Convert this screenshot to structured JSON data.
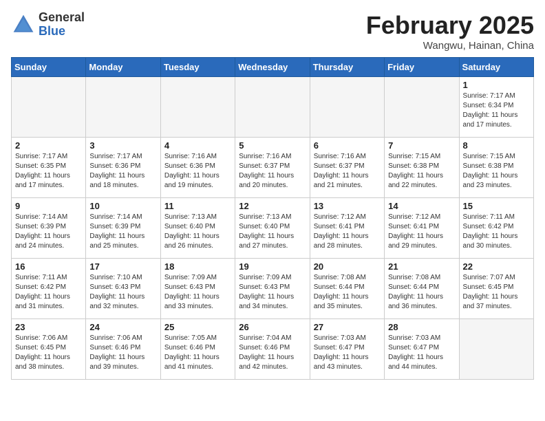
{
  "header": {
    "logo": {
      "line1": "General",
      "line2": "Blue"
    },
    "title": "February 2025",
    "location": "Wangwu, Hainan, China"
  },
  "weekdays": [
    "Sunday",
    "Monday",
    "Tuesday",
    "Wednesday",
    "Thursday",
    "Friday",
    "Saturday"
  ],
  "weeks": [
    [
      {
        "day": null
      },
      {
        "day": null
      },
      {
        "day": null
      },
      {
        "day": null
      },
      {
        "day": null
      },
      {
        "day": null
      },
      {
        "day": 1,
        "sunrise": "7:17 AM",
        "sunset": "6:34 PM",
        "daylight": "11 hours and 17 minutes."
      }
    ],
    [
      {
        "day": 2,
        "sunrise": "7:17 AM",
        "sunset": "6:35 PM",
        "daylight": "11 hours and 17 minutes."
      },
      {
        "day": 3,
        "sunrise": "7:17 AM",
        "sunset": "6:36 PM",
        "daylight": "11 hours and 18 minutes."
      },
      {
        "day": 4,
        "sunrise": "7:16 AM",
        "sunset": "6:36 PM",
        "daylight": "11 hours and 19 minutes."
      },
      {
        "day": 5,
        "sunrise": "7:16 AM",
        "sunset": "6:37 PM",
        "daylight": "11 hours and 20 minutes."
      },
      {
        "day": 6,
        "sunrise": "7:16 AM",
        "sunset": "6:37 PM",
        "daylight": "11 hours and 21 minutes."
      },
      {
        "day": 7,
        "sunrise": "7:15 AM",
        "sunset": "6:38 PM",
        "daylight": "11 hours and 22 minutes."
      },
      {
        "day": 8,
        "sunrise": "7:15 AM",
        "sunset": "6:38 PM",
        "daylight": "11 hours and 23 minutes."
      }
    ],
    [
      {
        "day": 9,
        "sunrise": "7:14 AM",
        "sunset": "6:39 PM",
        "daylight": "11 hours and 24 minutes."
      },
      {
        "day": 10,
        "sunrise": "7:14 AM",
        "sunset": "6:39 PM",
        "daylight": "11 hours and 25 minutes."
      },
      {
        "day": 11,
        "sunrise": "7:13 AM",
        "sunset": "6:40 PM",
        "daylight": "11 hours and 26 minutes."
      },
      {
        "day": 12,
        "sunrise": "7:13 AM",
        "sunset": "6:40 PM",
        "daylight": "11 hours and 27 minutes."
      },
      {
        "day": 13,
        "sunrise": "7:12 AM",
        "sunset": "6:41 PM",
        "daylight": "11 hours and 28 minutes."
      },
      {
        "day": 14,
        "sunrise": "7:12 AM",
        "sunset": "6:41 PM",
        "daylight": "11 hours and 29 minutes."
      },
      {
        "day": 15,
        "sunrise": "7:11 AM",
        "sunset": "6:42 PM",
        "daylight": "11 hours and 30 minutes."
      }
    ],
    [
      {
        "day": 16,
        "sunrise": "7:11 AM",
        "sunset": "6:42 PM",
        "daylight": "11 hours and 31 minutes."
      },
      {
        "day": 17,
        "sunrise": "7:10 AM",
        "sunset": "6:43 PM",
        "daylight": "11 hours and 32 minutes."
      },
      {
        "day": 18,
        "sunrise": "7:09 AM",
        "sunset": "6:43 PM",
        "daylight": "11 hours and 33 minutes."
      },
      {
        "day": 19,
        "sunrise": "7:09 AM",
        "sunset": "6:43 PM",
        "daylight": "11 hours and 34 minutes."
      },
      {
        "day": 20,
        "sunrise": "7:08 AM",
        "sunset": "6:44 PM",
        "daylight": "11 hours and 35 minutes."
      },
      {
        "day": 21,
        "sunrise": "7:08 AM",
        "sunset": "6:44 PM",
        "daylight": "11 hours and 36 minutes."
      },
      {
        "day": 22,
        "sunrise": "7:07 AM",
        "sunset": "6:45 PM",
        "daylight": "11 hours and 37 minutes."
      }
    ],
    [
      {
        "day": 23,
        "sunrise": "7:06 AM",
        "sunset": "6:45 PM",
        "daylight": "11 hours and 38 minutes."
      },
      {
        "day": 24,
        "sunrise": "7:06 AM",
        "sunset": "6:46 PM",
        "daylight": "11 hours and 39 minutes."
      },
      {
        "day": 25,
        "sunrise": "7:05 AM",
        "sunset": "6:46 PM",
        "daylight": "11 hours and 41 minutes."
      },
      {
        "day": 26,
        "sunrise": "7:04 AM",
        "sunset": "6:46 PM",
        "daylight": "11 hours and 42 minutes."
      },
      {
        "day": 27,
        "sunrise": "7:03 AM",
        "sunset": "6:47 PM",
        "daylight": "11 hours and 43 minutes."
      },
      {
        "day": 28,
        "sunrise": "7:03 AM",
        "sunset": "6:47 PM",
        "daylight": "11 hours and 44 minutes."
      },
      {
        "day": null
      }
    ]
  ]
}
